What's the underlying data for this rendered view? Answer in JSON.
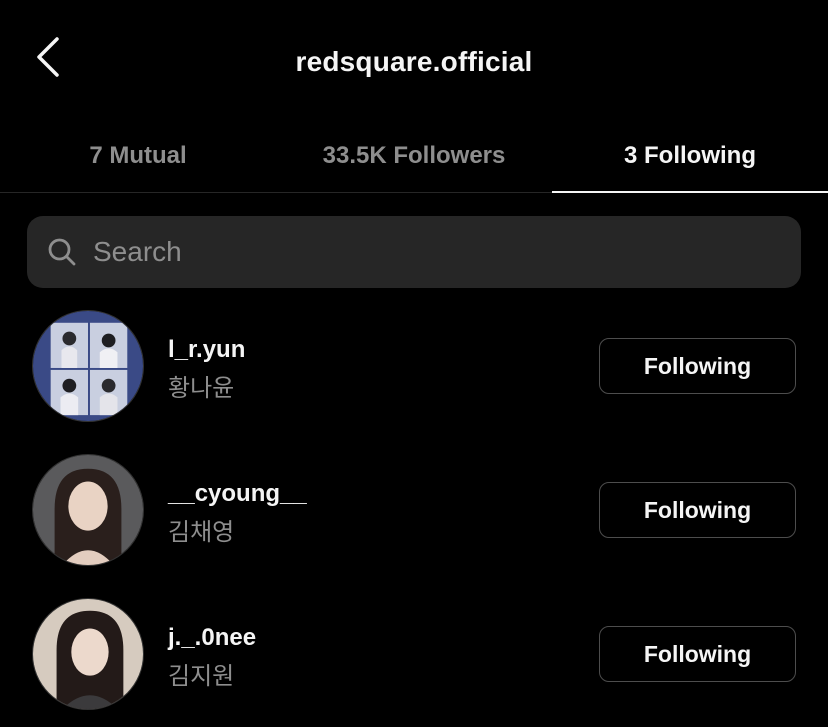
{
  "header": {
    "title": "redsquare.official",
    "back_icon": "chevron-left-icon"
  },
  "tabs": [
    {
      "label": "7 Mutual",
      "active": false
    },
    {
      "label": "33.5K Followers",
      "active": false
    },
    {
      "label": "3 Following",
      "active": true
    }
  ],
  "search": {
    "placeholder": "Search",
    "value": "",
    "icon": "search-icon"
  },
  "users": [
    {
      "username": "l_r.yun",
      "fullname": "황나윤",
      "button_label": "Following"
    },
    {
      "username": "__cyoung__",
      "fullname": "김채영",
      "button_label": "Following"
    },
    {
      "username": "j._.0nee",
      "fullname": "김지원",
      "button_label": "Following"
    }
  ],
  "colors": {
    "background": "#000000",
    "text_primary": "#f5f5f5",
    "text_secondary": "#8e8e8e",
    "search_bg": "#262626",
    "button_border": "#4d4d4d"
  }
}
